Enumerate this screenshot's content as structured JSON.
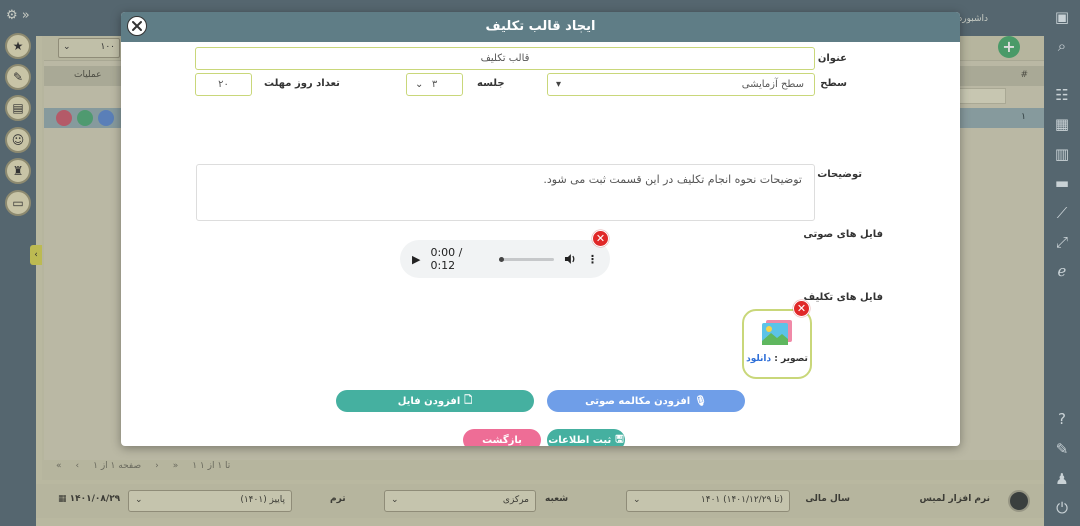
{
  "modal": {
    "title": "ایجاد قالب تکلیف",
    "fields": {
      "title_label": "عنوان",
      "title_value": "قالب تکلیف",
      "level_label": "سطح",
      "level_value": "سطح آزمایشی",
      "session_label": "جلسه",
      "session_value": "۳",
      "deadline_label": "تعداد روز مهلت",
      "deadline_value": "۲۰",
      "desc_label": "توضیحات",
      "desc_value": "توضیحات نحوه انجام تکلیف در این قسمت ثبت می شود.",
      "audio_label": "فایل های صوتی",
      "files_label": "فایل های تکلیف"
    },
    "audio": {
      "time": "0:00 / 0:12",
      "progress": 0.0
    },
    "file_item": {
      "caption_prefix": "تصویر : ",
      "download": "دانلود"
    },
    "buttons": {
      "add_file": "افزودن فایل",
      "add_voice": "افزودن مکالمه صوتی",
      "submit": "ثبت اطلاعات",
      "back": "بازگشت"
    }
  },
  "background": {
    "dashboard": "داشبورد",
    "page_size": "۱۰۰",
    "col_operations": "عملیات",
    "col_hash": "#",
    "row_number": "۱",
    "pager_text": "صفحه ۱ از ۱",
    "pager_count": "۱ تا ۱ از ۱",
    "footer": {
      "user": "نرم افزار لمیس",
      "year_label": "سال مالی",
      "year_value": "۱۴۰۱ (تا ۱۴۰۱/۱۲/۲۹)",
      "branch_label": "شعبه",
      "branch_value": "مرکزی",
      "term_label": "ترم",
      "term_value": "پاییز (۱۴۰۱)",
      "date": "۱۴۰۱/۰۸/۲۹"
    }
  },
  "colors": {
    "header": "#5f7d86",
    "teal": "#45b0a0",
    "blue": "#6f9ee8",
    "pink": "#ee6d96",
    "input_border": "#c9d77a",
    "danger": "#e02828"
  }
}
